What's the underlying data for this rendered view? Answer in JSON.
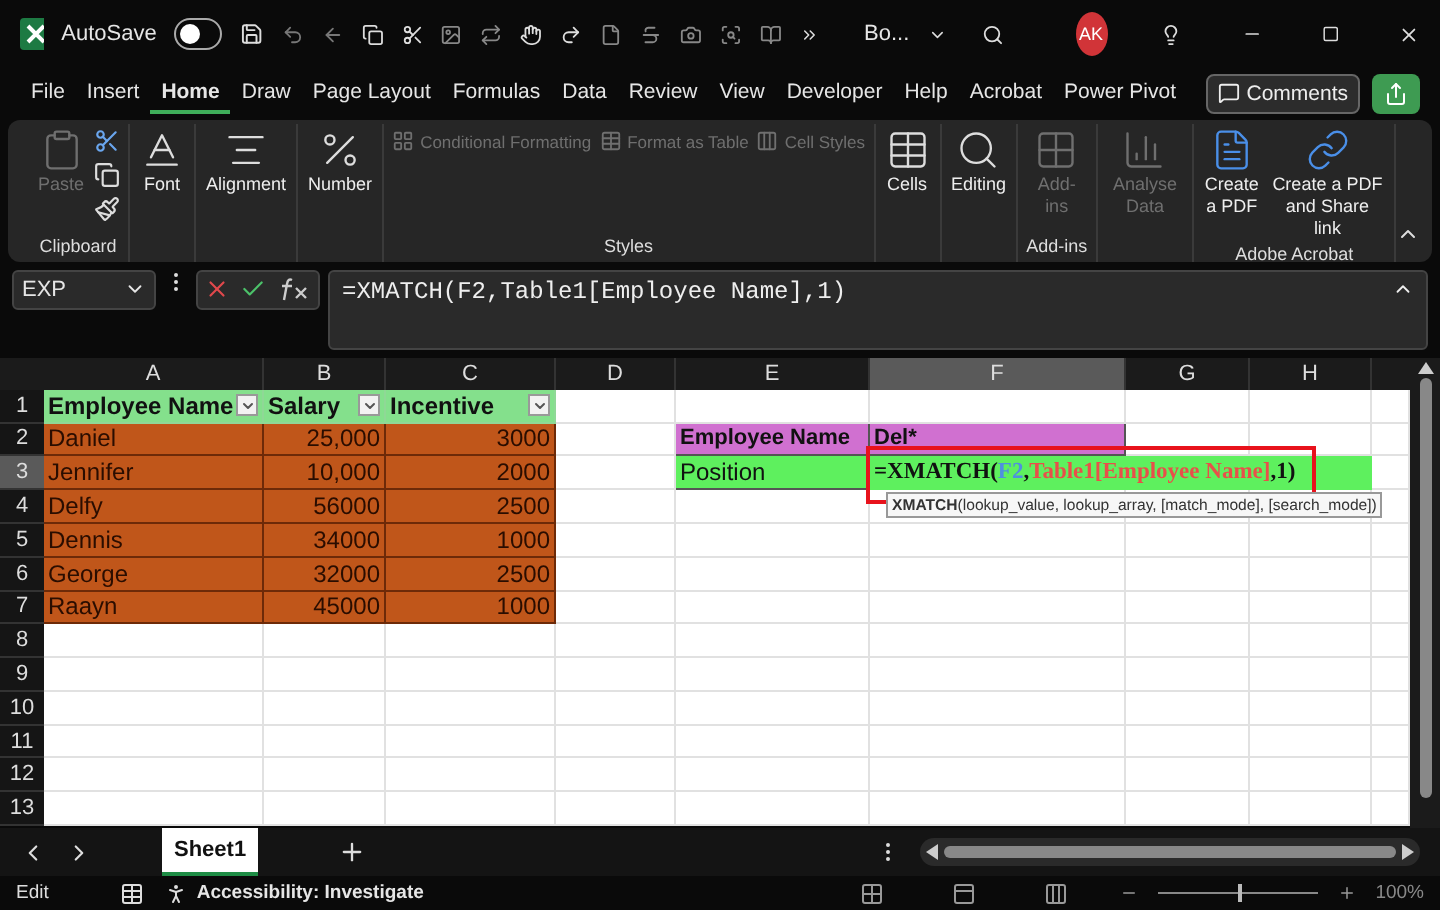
{
  "title_bar": {
    "autosave_label": "AutoSave",
    "autosave": {
      "on": false
    },
    "title": "Bo...",
    "avatar": "AK"
  },
  "menu": [
    {
      "label": "File",
      "selected": false
    },
    {
      "label": "Insert",
      "selected": false
    },
    {
      "label": "Home",
      "selected": true
    },
    {
      "label": "Draw",
      "selected": false
    },
    {
      "label": "Page Layout",
      "selected": false
    },
    {
      "label": "Formulas",
      "selected": false
    },
    {
      "label": "Data",
      "selected": false
    },
    {
      "label": "Review",
      "selected": false
    },
    {
      "label": "View",
      "selected": false
    },
    {
      "label": "Developer",
      "selected": false
    },
    {
      "label": "Help",
      "selected": false
    },
    {
      "label": "Acrobat",
      "selected": false
    },
    {
      "label": "Power Pivot",
      "selected": false
    }
  ],
  "comments_button": "Comments",
  "ribbon": [
    {
      "label": "Clipboard",
      "items": [
        {
          "label": "Paste",
          "kind": "large",
          "disabled": true
        }
      ]
    },
    {
      "items": [
        {
          "label": "Font",
          "kind": "large",
          "disabled": false
        }
      ]
    },
    {
      "items": [
        {
          "label": "Alignment",
          "kind": "large",
          "disabled": false
        }
      ]
    },
    {
      "items": [
        {
          "label": "Number",
          "kind": "large",
          "disabled": false
        }
      ]
    },
    {
      "label": "Styles",
      "items": [
        {
          "label": "Conditional Formatting",
          "kind": "small",
          "disabled": true
        },
        {
          "label": "Format as Table",
          "kind": "small",
          "disabled": true
        },
        {
          "label": "Cell Styles",
          "kind": "small",
          "disabled": true
        }
      ]
    },
    {
      "items": [
        {
          "label": "Cells",
          "kind": "large",
          "disabled": false
        }
      ]
    },
    {
      "items": [
        {
          "label": "Editing",
          "kind": "large",
          "disabled": false
        }
      ]
    },
    {
      "label": "Add-ins",
      "items": [
        {
          "label": "Add-ins",
          "kind": "large",
          "disabled": true
        }
      ]
    },
    {
      "items": [
        {
          "label": "Analyse Data",
          "kind": "large",
          "disabled": true
        }
      ]
    },
    {
      "label": "Adobe Acrobat",
      "items": [
        {
          "label": "Create a PDF",
          "kind": "large",
          "disabled": false
        },
        {
          "label": "Create a PDF and Share link",
          "kind": "large",
          "disabled": false
        }
      ]
    }
  ],
  "formula_bar": {
    "name_box": "EXP",
    "formula": "=XMATCH(F2,Table1[Employee Name],1)"
  },
  "columns": [
    {
      "label": "A",
      "selected": false
    },
    {
      "label": "B",
      "selected": false
    },
    {
      "label": "C",
      "selected": false
    },
    {
      "label": "D",
      "selected": false
    },
    {
      "label": "E",
      "selected": false
    },
    {
      "label": "F",
      "selected": true
    },
    {
      "label": "G",
      "selected": false
    },
    {
      "label": "H",
      "selected": false
    }
  ],
  "rows": [
    {
      "label": "1",
      "selected": false,
      "cells": [
        {
          "kind": "header",
          "text": "Employee Name"
        },
        {
          "kind": "header",
          "text": "Salary"
        },
        {
          "kind": "header",
          "text": "Incentive"
        }
      ]
    },
    {
      "label": "2",
      "selected": false,
      "cells": [
        {
          "kind": "name",
          "text": "Daniel"
        },
        {
          "kind": "number",
          "text": "25,000"
        },
        {
          "kind": "number",
          "text": "3000"
        },
        {
          "kind": "empty"
        },
        {
          "kind": "pink",
          "text": "Employee Name"
        },
        {
          "kind": "pink",
          "text": "Del*"
        }
      ]
    },
    {
      "label": "3",
      "selected": true,
      "cells": [
        {
          "kind": "name",
          "text": "Jennifer"
        },
        {
          "kind": "number",
          "text": "10,000"
        },
        {
          "kind": "number",
          "text": "2000"
        },
        {
          "kind": "empty"
        },
        {
          "kind": "green",
          "text": "Position"
        },
        {
          "kind": "formula",
          "parts": [
            {
              "text": "=XMATCH(",
              "color": "#111111"
            },
            {
              "text": "F2",
              "color": "#4f8fe0"
            },
            {
              "text": ",",
              "color": "#111111"
            },
            {
              "text": "Table1[Employee Name]",
              "color": "#e8504a"
            },
            {
              "text": ",1)",
              "color": "#111111"
            }
          ]
        }
      ]
    },
    {
      "label": "4",
      "selected": false,
      "cells": [
        {
          "kind": "name",
          "text": "Delfy"
        },
        {
          "kind": "number",
          "text": "56000"
        },
        {
          "kind": "number",
          "text": "2500"
        }
      ]
    },
    {
      "label": "5",
      "selected": false,
      "cells": [
        {
          "kind": "name",
          "text": "Dennis"
        },
        {
          "kind": "number",
          "text": "34000"
        },
        {
          "kind": "number",
          "text": "1000"
        }
      ]
    },
    {
      "label": "6",
      "selected": false,
      "cells": [
        {
          "kind": "name",
          "text": "George"
        },
        {
          "kind": "number",
          "text": "32000"
        },
        {
          "kind": "number",
          "text": "2500"
        }
      ]
    },
    {
      "label": "7",
      "selected": false,
      "cells": [
        {
          "kind": "name",
          "text": "Raayn"
        },
        {
          "kind": "number",
          "text": "45000"
        },
        {
          "kind": "number",
          "text": "1000"
        }
      ]
    },
    {
      "label": "8",
      "selected": false
    },
    {
      "label": "9",
      "selected": false
    },
    {
      "label": "10",
      "selected": false
    },
    {
      "label": "11",
      "selected": false
    },
    {
      "label": "12",
      "selected": false
    },
    {
      "label": "13",
      "selected": false
    }
  ],
  "tooltip": "**XMATCH**(lookup_value, lookup_array, [match_mode], [search_mode])",
  "sheets": [
    {
      "label": "Sheet1",
      "selected": true
    }
  ],
  "status_bar": {
    "mode": "Edit",
    "accessibility": "Accessibility: Investigate",
    "zoom": {
      "level": 0.5
    },
    "zoom_text": "100%"
  }
}
